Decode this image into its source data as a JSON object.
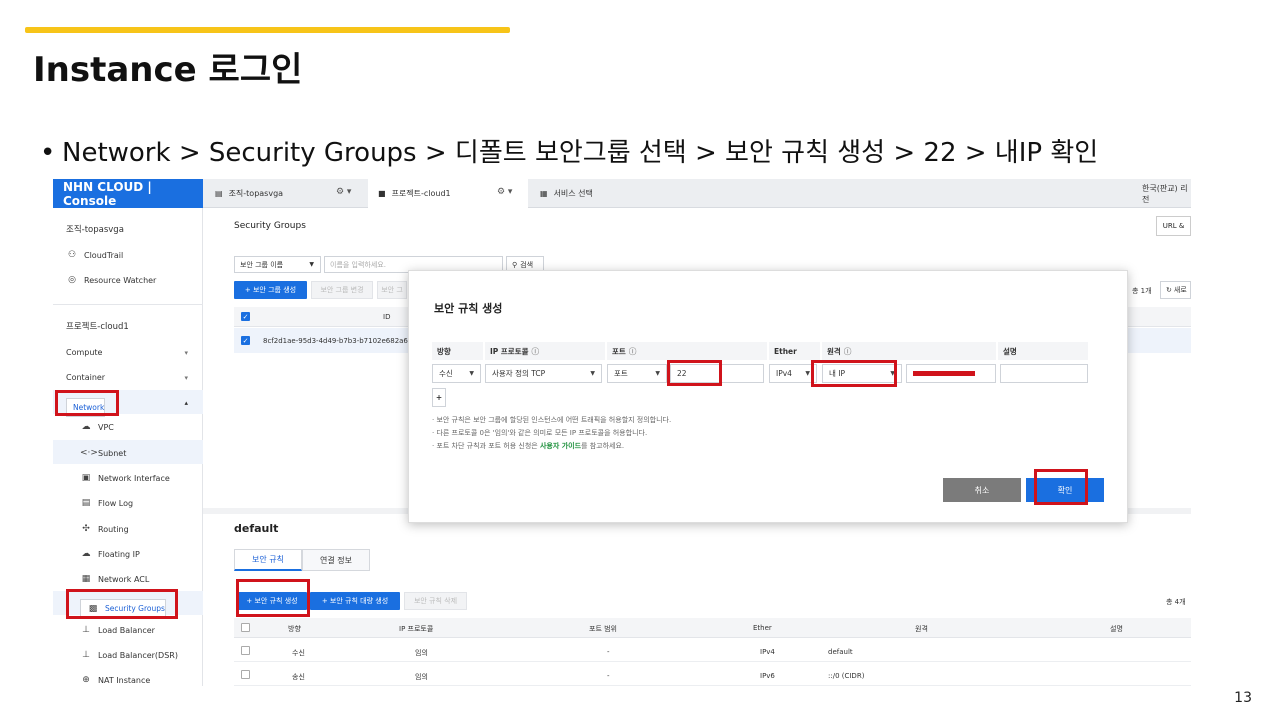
{
  "slide": {
    "title": "Instance 로그인",
    "bullet": "Network > Security Groups > 디폴트 보안그룹 선택 > 보안 규칙 생성 > 22 > 내IP 확인",
    "page_number": "13",
    "accent_color": "#f7c418"
  },
  "console": {
    "brand": "NHN CLOUD | Console",
    "tabs": {
      "org": "조직-topasvga",
      "project": "프로젝트-cloud1",
      "services": "서비스 선택",
      "region": "한국(판교) 리전"
    },
    "sidebar": {
      "org_name": "조직-topasvga",
      "org_items": [
        {
          "label": "CloudTrail",
          "icon": "cloudtrail-icon"
        },
        {
          "label": "Resource Watcher",
          "icon": "resource-watcher-icon"
        }
      ],
      "project_name": "프로젝트-cloud1",
      "groups": [
        "Compute",
        "Container",
        "Network"
      ],
      "network_items": [
        {
          "label": "VPC",
          "icon": "cloud-icon"
        },
        {
          "label": "Subnet",
          "icon": "subnet-icon"
        },
        {
          "label": "Network Interface",
          "icon": "network-interface-icon"
        },
        {
          "label": "Flow Log",
          "icon": "flow-log-icon"
        },
        {
          "label": "Routing",
          "icon": "routing-icon"
        },
        {
          "label": "Floating IP",
          "icon": "floating-ip-icon"
        },
        {
          "label": "Network ACL",
          "icon": "network-acl-icon"
        },
        {
          "label": "Security Groups",
          "icon": "security-groups-icon"
        },
        {
          "label": "Load Balancer",
          "icon": "load-balancer-icon"
        },
        {
          "label": "Load Balancer(DSR)",
          "icon": "load-balancer-dsr-icon"
        },
        {
          "label": "NAT Instance",
          "icon": "nat-instance-icon"
        }
      ]
    },
    "main": {
      "title": "Security Groups",
      "url_button": "URL &",
      "search_select": "보안 그룹 이름",
      "search_placeholder": "이름을 입력하세요.",
      "search_button": "검색",
      "create_button": "+ 보안 그룹 생성",
      "edit_button": "보안 그룹 변경",
      "delete_button": "보안 그",
      "total": "총 1개",
      "refresh": "새로",
      "col_id": "ID",
      "row_id": "8cf2d1ae-95d3-4d49-b7b3-b7102e682a6",
      "detail_title": "default",
      "detail_tabs": [
        "보안 규칙",
        "연결 정보"
      ],
      "rule_create": "+ 보안 규칙 생성",
      "rule_bulk_create": "+ 보안 규칙 대량 생성",
      "rule_delete": "보안 규칙 삭제",
      "rule_total": "총 4개",
      "rule_columns": [
        "방향",
        "IP 프로토콜",
        "포트 범위",
        "Ether",
        "원격",
        "설명"
      ],
      "rules": [
        {
          "direction": "수신",
          "protocol": "임의",
          "port": "-",
          "ether": "IPv4",
          "remote": "default",
          "desc": ""
        },
        {
          "direction": "송신",
          "protocol": "임의",
          "port": "-",
          "ether": "IPv6",
          "remote": "::/0 (CIDR)",
          "desc": ""
        }
      ]
    },
    "modal": {
      "title": "보안 규칙 생성",
      "headers": [
        "방향",
        "IP 프로토콜",
        "포트",
        "Ether",
        "원격",
        "설명"
      ],
      "direction": "수신",
      "protocol": "사용자 정의 TCP",
      "port_type": "포트",
      "port_value": "22",
      "ether": "IPv4",
      "remote": "내 IP",
      "add_button": "+",
      "notes": [
        "· 보안 규칙은 보안 그룹에 할당된 인스턴스에 어떤 트래픽을 허용할지 정의합니다.",
        "· 다른 프로토콜 0은 '임의'와 같은 의미로 모든 IP 프로토콜을 허용합니다."
      ],
      "note3_prefix": "· 포트 차단 규칙과 포트 허용 신청은 ",
      "note3_link": "사용자 가이드",
      "note3_suffix": "를 참고하세요.",
      "cancel": "취소",
      "confirm": "확인"
    }
  }
}
